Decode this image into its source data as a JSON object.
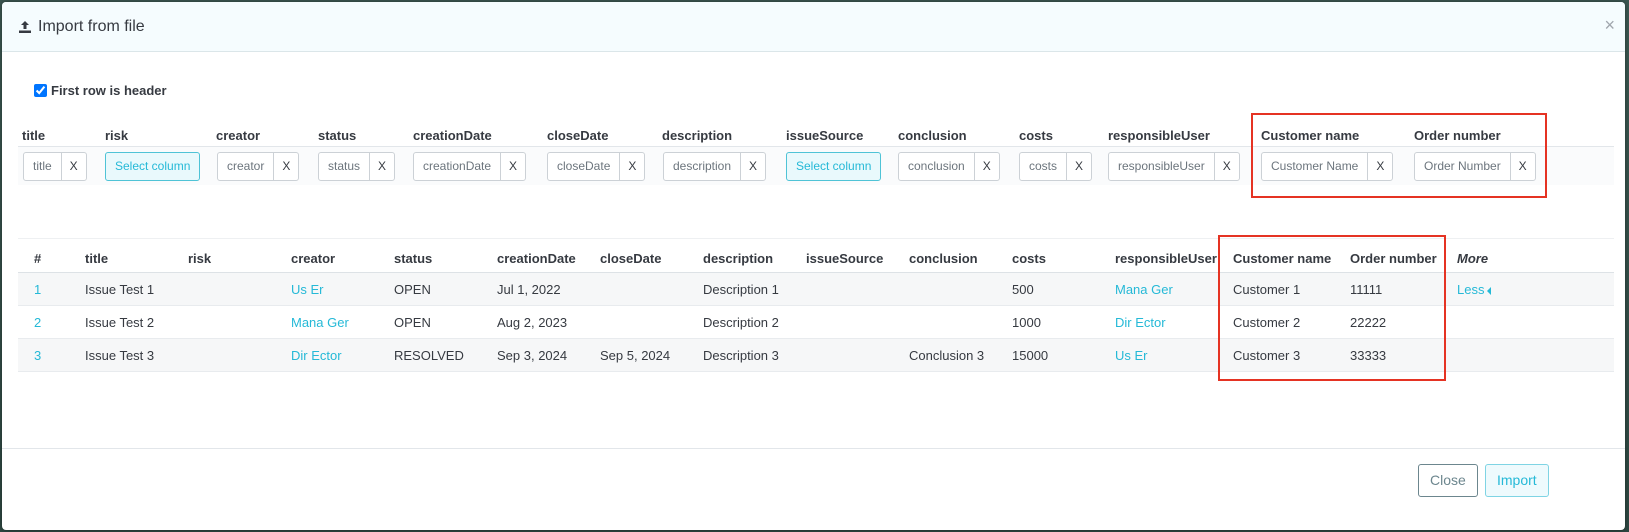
{
  "modal": {
    "title": "Import from file",
    "close_glyph": "×",
    "header_checkbox": {
      "label": "First row is header",
      "checked": true
    }
  },
  "mapping": {
    "columns": [
      {
        "label": "title",
        "field": "title",
        "remove": "X"
      },
      {
        "label": "risk",
        "select": "Select column"
      },
      {
        "label": "creator",
        "field": "creator",
        "remove": "X"
      },
      {
        "label": "status",
        "field": "status",
        "remove": "X"
      },
      {
        "label": "creationDate",
        "field": "creationDate",
        "remove": "X"
      },
      {
        "label": "closeDate",
        "field": "closeDate",
        "remove": "X"
      },
      {
        "label": "description",
        "field": "description",
        "remove": "X"
      },
      {
        "label": "issueSource",
        "select": "Select column"
      },
      {
        "label": "conclusion",
        "field": "conclusion",
        "remove": "X"
      },
      {
        "label": "costs",
        "field": "costs",
        "remove": "X"
      },
      {
        "label": "responsibleUser",
        "field": "responsibleUser",
        "remove": "X"
      },
      {
        "label": "Customer name",
        "field": "Customer Name",
        "remove": "X"
      },
      {
        "label": "Order number",
        "field": "Order Number",
        "remove": "X"
      }
    ]
  },
  "preview": {
    "headers": [
      "#",
      "title",
      "risk",
      "creator",
      "status",
      "creationDate",
      "closeDate",
      "description",
      "issueSource",
      "conclusion",
      "costs",
      "responsibleUser",
      "Customer name",
      "Order number",
      "More"
    ],
    "rows": [
      [
        "1",
        "Issue Test 1",
        "",
        "Us Er",
        "OPEN",
        "Jul 1, 2022",
        "",
        "Description 1",
        "",
        "",
        "500",
        "Mana Ger",
        "Customer 1",
        "11111",
        "Less"
      ],
      [
        "2",
        "Issue Test 2",
        "",
        "Mana Ger",
        "OPEN",
        "Aug 2, 2023",
        "",
        "Description 2",
        "",
        "",
        "1000",
        "Dir Ector",
        "Customer 2",
        "22222",
        ""
      ],
      [
        "3",
        "Issue Test 3",
        "",
        "Dir Ector",
        "RESOLVED",
        "Sep 3, 2024",
        "Sep 5, 2024",
        "Description 3",
        "",
        "Conclusion 3",
        "15000",
        "Us Er",
        "Customer 3",
        "33333",
        ""
      ]
    ]
  },
  "footer": {
    "close_label": "Close",
    "import_label": "Import"
  },
  "colors": {
    "accent": "#25b9d7",
    "highlight": "#e53323",
    "header_bg": "#f5fcfe"
  }
}
